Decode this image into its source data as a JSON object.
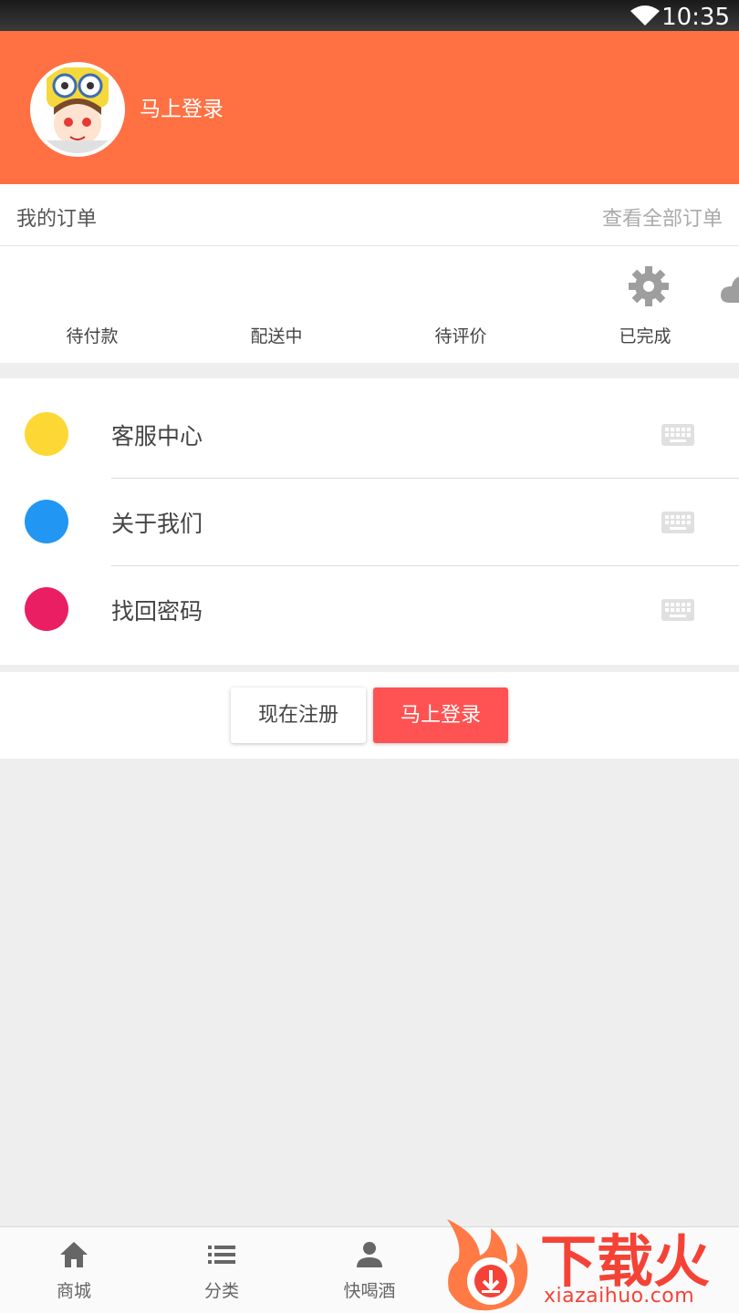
{
  "status_bar": {
    "time": "10:35"
  },
  "header": {
    "login_text": "马上登录",
    "avatar_label": ""
  },
  "orders": {
    "title": "我的订单",
    "view_all": "查看全部订单"
  },
  "order_status": [
    {
      "label": "待付款"
    },
    {
      "label": "配送中"
    },
    {
      "label": "待评价"
    },
    {
      "label": "已完成",
      "icon": "gear-icon"
    }
  ],
  "menu": [
    {
      "label": "客服中心",
      "color": "#fdd835"
    },
    {
      "label": "关于我们",
      "color": "#2196f3"
    },
    {
      "label": "找回密码",
      "color": "#e91e63"
    }
  ],
  "actions": {
    "register": "现在注册",
    "login": "马上登录"
  },
  "tabbar": [
    {
      "label": "商城",
      "icon": "home-icon"
    },
    {
      "label": "分类",
      "icon": "list-icon"
    },
    {
      "label": "快喝酒",
      "icon": "person-icon"
    }
  ],
  "watermark": {
    "brand": "下载火",
    "site": "xiazaihuo.com"
  },
  "colors": {
    "header": "#ff7043",
    "login_button": "#ff5252",
    "watermark": "#f44336"
  }
}
